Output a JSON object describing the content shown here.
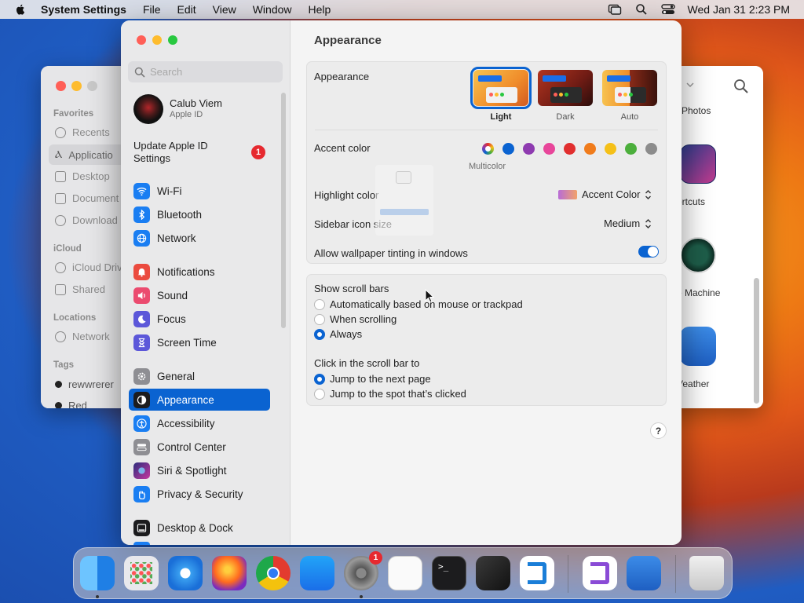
{
  "menubar": {
    "app_name": "System Settings",
    "items": [
      "File",
      "Edit",
      "View",
      "Window",
      "Help"
    ],
    "clock": "Wed Jan 31  2:23 PM"
  },
  "finder": {
    "sections": {
      "favorites": "Favorites",
      "icloud": "iCloud",
      "locations": "Locations",
      "tags": "Tags"
    },
    "items": {
      "recents": "Recents",
      "applications": "Applicatio",
      "desktop": "Desktop",
      "documents": "Document",
      "downloads": "Download",
      "icloud_drive": "iCloud Driv",
      "shared": "Shared",
      "network": "Network",
      "tag1": "rewwrerer",
      "tag2": "Red"
    },
    "apps": {
      "photos": "Photos",
      "shortcuts": "ortcuts",
      "time_machine": "e Machine",
      "weather": "Veather"
    }
  },
  "settings": {
    "search_placeholder": "Search",
    "user": {
      "name": "Calub Viem",
      "sub": "Apple ID"
    },
    "update": {
      "label": "Update Apple ID Settings",
      "badge": "1"
    },
    "nav": {
      "wifi": "Wi-Fi",
      "bluetooth": "Bluetooth",
      "network": "Network",
      "notifications": "Notifications",
      "sound": "Sound",
      "focus": "Focus",
      "screen_time": "Screen Time",
      "general": "General",
      "appearance": "Appearance",
      "accessibility": "Accessibility",
      "control_center": "Control Center",
      "siri": "Siri & Spotlight",
      "privacy": "Privacy & Security",
      "desktop_dock": "Desktop & Dock"
    },
    "panel": {
      "title": "Appearance",
      "appearance_label": "Appearance",
      "modes": {
        "light": "Light",
        "dark": "Dark",
        "auto": "Auto"
      },
      "accent_label": "Accent color",
      "accent_selected": "Multicolor",
      "accent_colors": [
        "#0a63d1",
        "#8e3bb0",
        "#e8469a",
        "#e12f2f",
        "#f07c1c",
        "#f5c018",
        "#4caf3c",
        "#8c8c8c"
      ],
      "highlight_label": "Highlight color",
      "highlight_value": "Accent Color",
      "sidebar_icon_label": "Sidebar icon size",
      "sidebar_icon_value": "Medium",
      "tinting_label": "Allow wallpaper tinting in windows",
      "scrollbars_title": "Show scroll bars",
      "scroll_opts": {
        "auto": "Automatically based on mouse or trackpad",
        "scrolling": "When scrolling",
        "always": "Always"
      },
      "click_title": "Click in the scroll bar to",
      "click_opts": {
        "next": "Jump to the next page",
        "spot": "Jump to the spot that’s clicked"
      },
      "help": "?"
    }
  },
  "dock": {
    "settings_badge": "1"
  }
}
